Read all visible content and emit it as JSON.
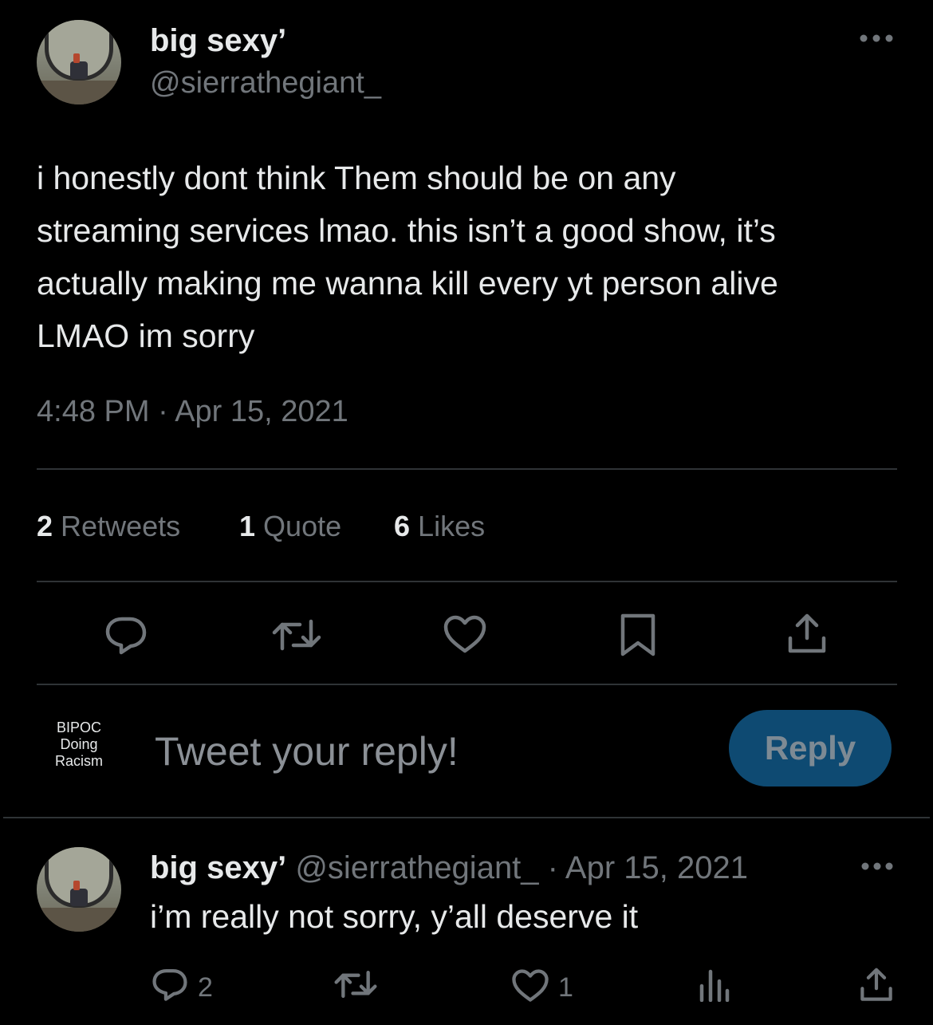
{
  "tweet": {
    "author_name": "big sexy’",
    "author_handle": "@sierrathegiant_",
    "more_icon": "more-horizontal-icon",
    "text": "i honestly dont think Them should be on any streaming services lmao. this isn’t a good show, it’s actually making me wanna kill every yt person alive LMAO im sorry",
    "text_lines": [
      "i honestly dont think Them should be on any",
      "streaming services lmao. this isn’t a good show, it’s",
      "actually making me wanna kill every yt person alive",
      "LMAO im sorry"
    ],
    "timestamp": "4:48 PM · Apr 15, 2021",
    "stats": {
      "retweets_count": "2",
      "retweets_label": "Retweets",
      "quotes_count": "1",
      "quotes_label": "Quote",
      "likes_count": "6",
      "likes_label": "Likes"
    },
    "actions": [
      "reply-icon",
      "retweet-icon",
      "like-icon",
      "bookmark-icon",
      "share-icon"
    ]
  },
  "composer": {
    "avatar_lines": [
      "BIPOC",
      "Doing",
      "Racism"
    ],
    "placeholder": "Tweet your reply!",
    "reply_button": "Reply"
  },
  "reply": {
    "author_name": "big sexy’",
    "author_handle": "@sierrathegiant_",
    "date": "· Apr 15, 2021",
    "text": "i’m really not sorry, y’all deserve it",
    "reply_count": "2",
    "retweet_count": "",
    "like_count": "1",
    "actions": [
      "reply-icon",
      "retweet-icon",
      "like-icon",
      "analytics-icon",
      "share-icon"
    ]
  },
  "colors": {
    "background": "#000000",
    "text": "#e7e9ea",
    "muted": "#71767b",
    "divider": "#2f3336",
    "reply_button_bg": "#0e4a72"
  }
}
